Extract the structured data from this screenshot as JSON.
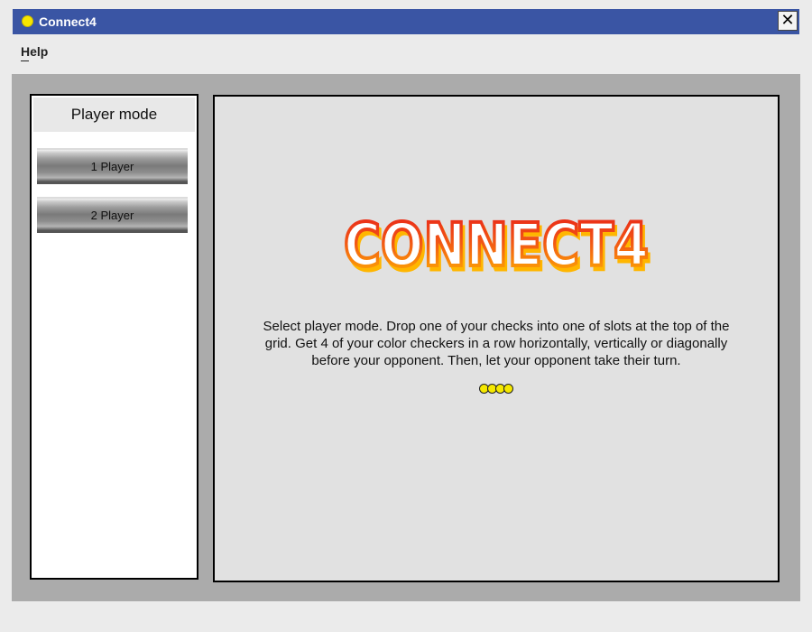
{
  "window": {
    "title": "Connect4",
    "close_label": "✕",
    "accent_color": "#3a55a4"
  },
  "menu": {
    "items": [
      {
        "label": "Help"
      }
    ]
  },
  "sidebar": {
    "header": "Player mode",
    "buttons": [
      {
        "label": "1 Player"
      },
      {
        "label": "2 Player"
      }
    ]
  },
  "main": {
    "logo_text": "CONNECT4",
    "logo_colors": {
      "top": "#e8201a",
      "bottom": "#ffb600",
      "outline": "#ffffff"
    },
    "description": "Select player mode. Drop one of your checks into one of slots at the top of the grid.  Get 4 of your color checkers in a row horizontally, vertically or diagonally before your opponent. Then, let your opponent take their turn.",
    "indicator_dots": 4,
    "dot_color": "#f5e800"
  }
}
